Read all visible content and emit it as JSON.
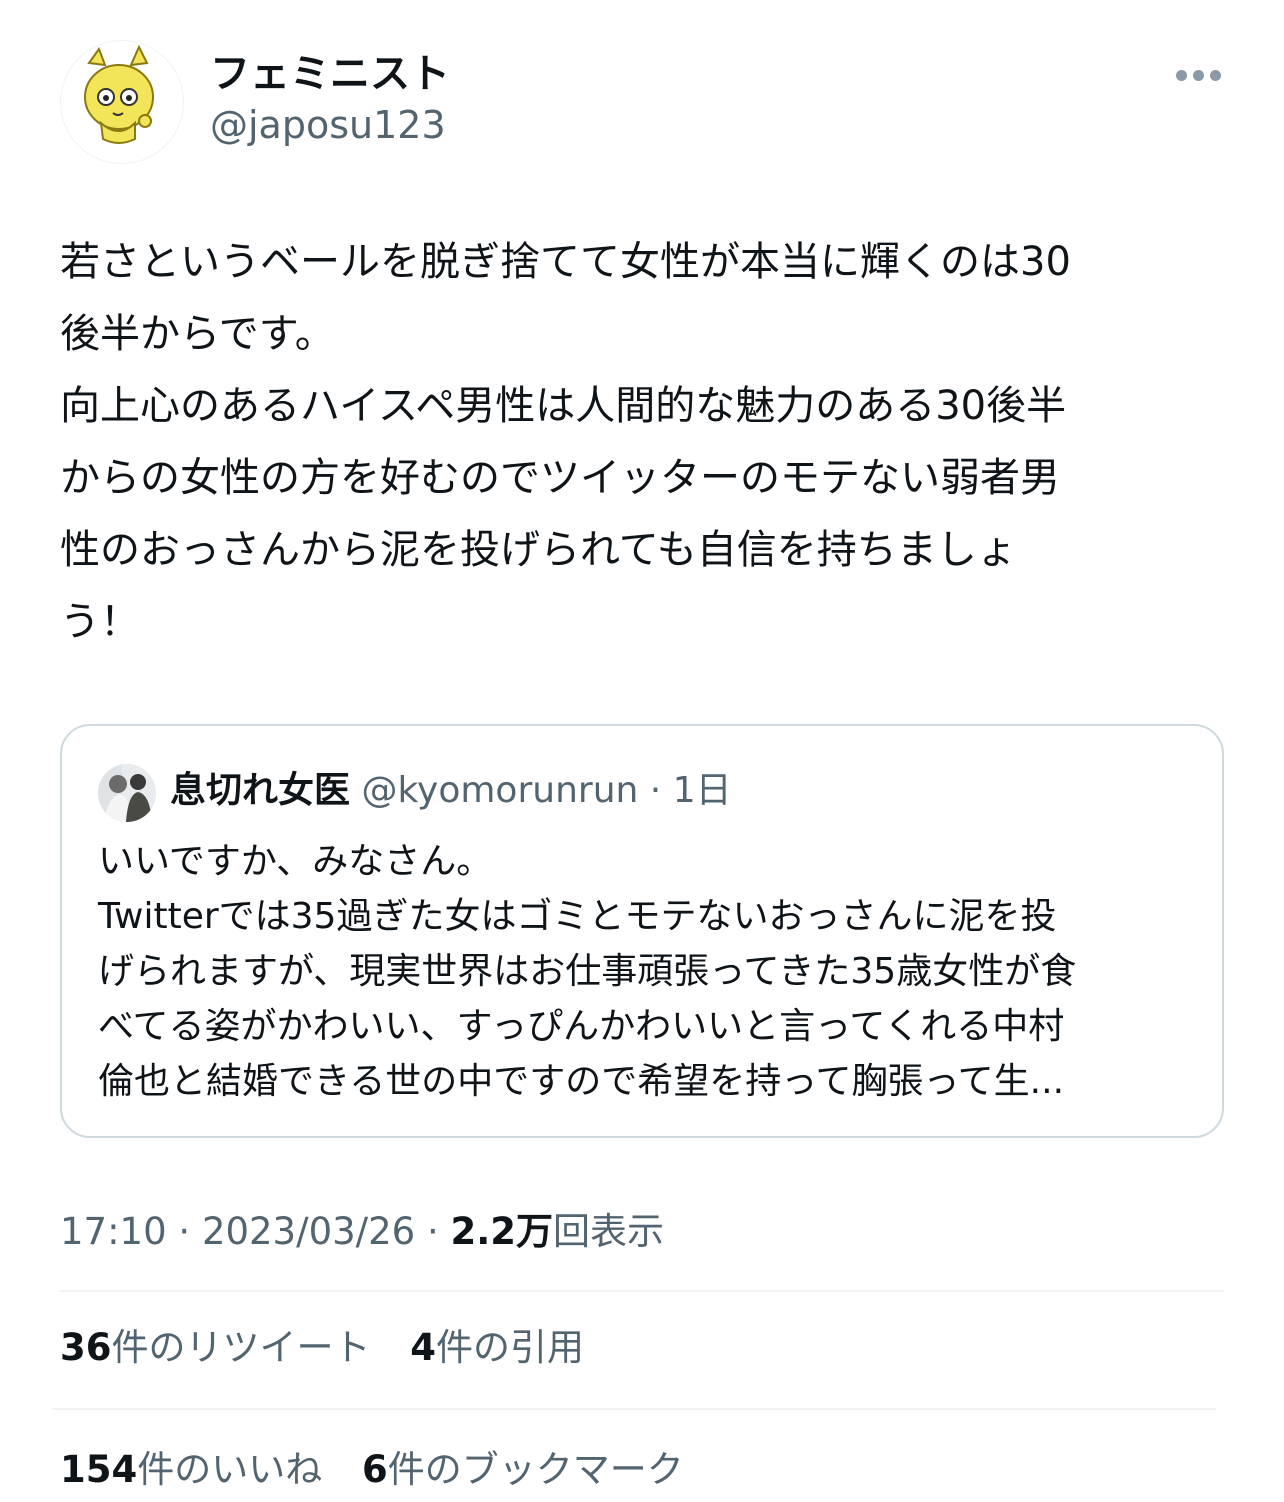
{
  "author": {
    "display_name": "フェミニスト",
    "handle": "@japosu123",
    "avatar_icon": "yellow-cartoon-character-icon"
  },
  "more_icon": "more-horizontal-icon",
  "tweet": {
    "lines": [
      "若さというベールを脱ぎ捨てて女性が本当に輝くのは30",
      "後半からです。",
      "向上心のあるハイスペ男性は人間的な魅力のある30後半",
      "からの女性の方を好むのでツイッターのモテない弱者男",
      "性のおっさんから泥を投げられても自信を持ちましょ",
      "う！"
    ]
  },
  "quote": {
    "display_name": "息切れ女医",
    "handle": "@kyomorunrun",
    "separator": "·",
    "time": "1日",
    "lines": [
      "いいですか、みなさん。",
      "Twitterでは35過ぎた女はゴミとモテないおっさんに泥を投",
      "げられますが、現実世界はお仕事頑張ってきた35歳女性が食",
      "べてる姿がかわいい、すっぴんかわいいと言ってくれる中村",
      "倫也と結婚できる世の中ですので希望を持って胸張って生..."
    ]
  },
  "meta": {
    "time": "17:10",
    "sep1": " · ",
    "date": "2023/03/26",
    "sep2": " · ",
    "views_count": "2.2万",
    "views_label": "回表示"
  },
  "stats": {
    "retweets_count": "36",
    "retweets_label": "件のリツイート",
    "quotes_count": "4",
    "quotes_label": "件の引用",
    "likes_count": "154",
    "likes_label": "件のいいね",
    "bookmarks_count": "6",
    "bookmarks_label": "件のブックマーク"
  },
  "colors": {
    "text": "#0f1419",
    "secondary": "#536471",
    "border": "#cfd9de",
    "avatar_yellow": "#f3e55a"
  }
}
